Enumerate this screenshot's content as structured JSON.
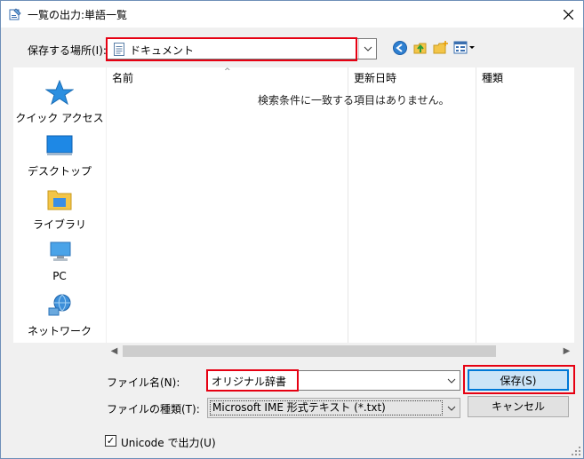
{
  "window": {
    "title": "一覧の出力:単語一覧"
  },
  "savein": {
    "label": "保存する場所(I):",
    "value": "ドキュメント"
  },
  "places": [
    {
      "label": "クイック アクセス",
      "icon": "star-icon"
    },
    {
      "label": "デスクトップ",
      "icon": "desktop-icon"
    },
    {
      "label": "ライブラリ",
      "icon": "library-folder-icon"
    },
    {
      "label": "PC",
      "icon": "computer-icon"
    },
    {
      "label": "ネットワーク",
      "icon": "network-icon"
    }
  ],
  "filelist": {
    "columns": [
      "名前",
      "更新日時",
      "種類"
    ],
    "empty_message": "検索条件に一致する項目はありません。"
  },
  "filename": {
    "label": "ファイル名(N):",
    "value": "オリジナル辞書"
  },
  "filetype": {
    "label": "ファイルの種類(T):",
    "value": "Microsoft IME 形式テキスト (*.txt)"
  },
  "buttons": {
    "save": "保存(S)",
    "cancel": "キャンセル"
  },
  "unicode": {
    "label": "Unicode で出力(U)",
    "checked": true
  },
  "colors": {
    "highlight": "#e60012",
    "accent": "#0078d7"
  }
}
